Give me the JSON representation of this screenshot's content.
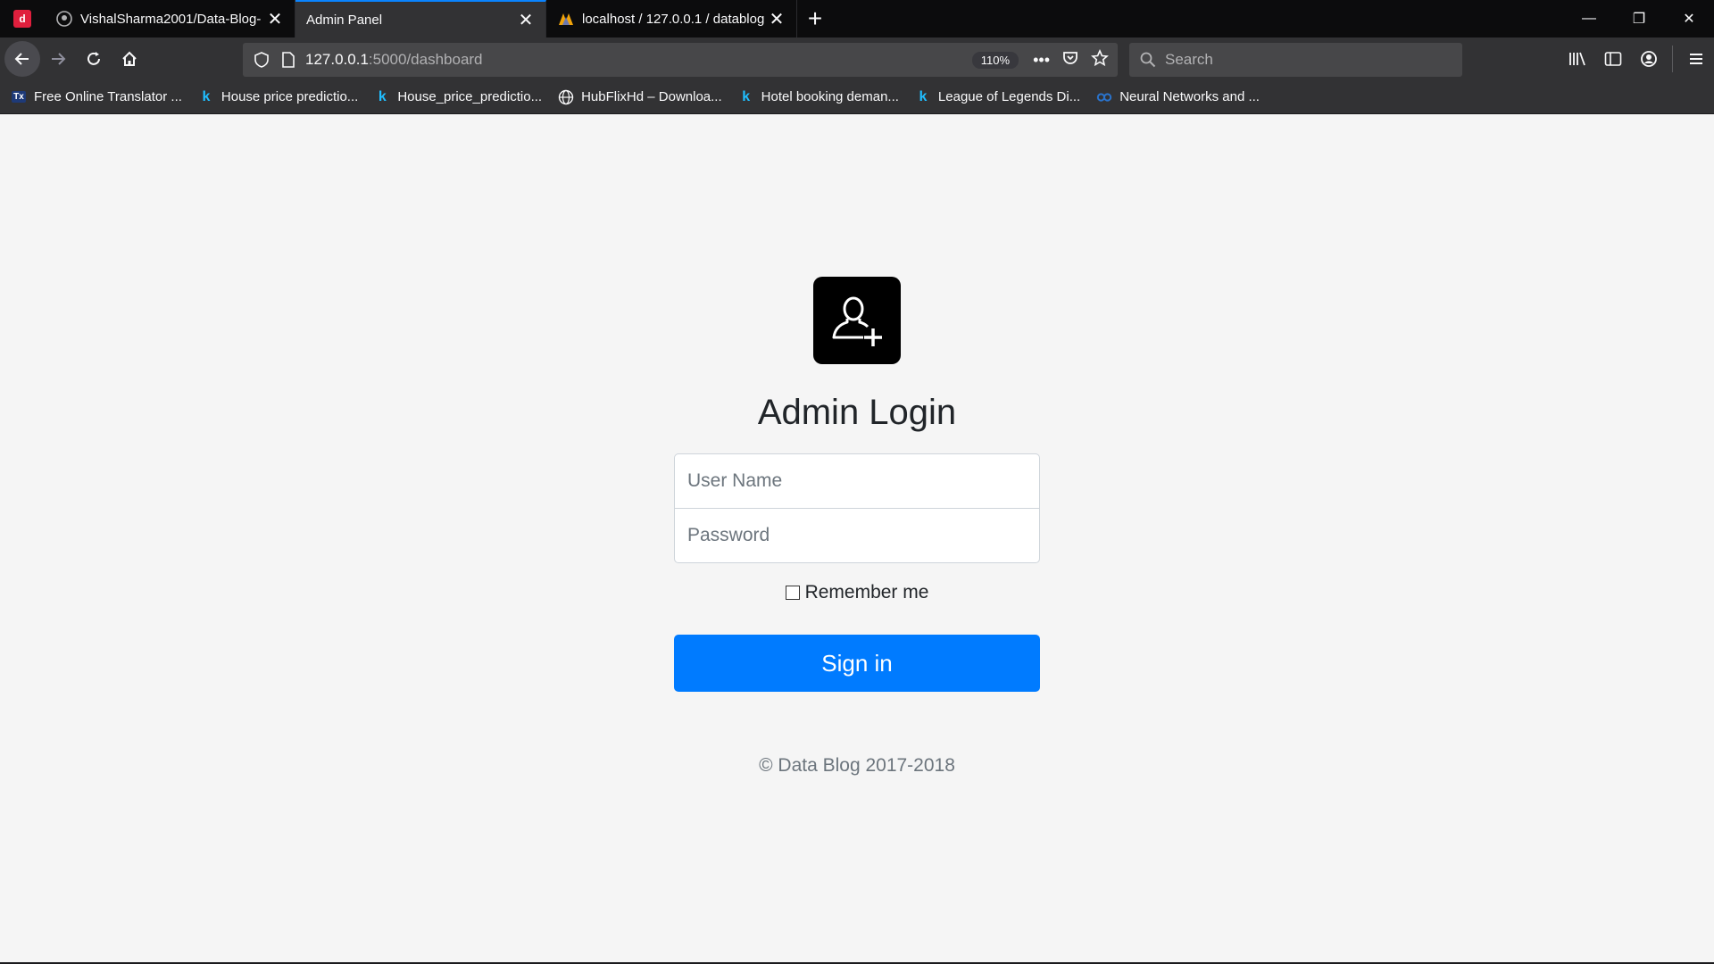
{
  "browser": {
    "tabs": [
      {
        "title": "VishalSharma2001/Data-Blog-",
        "icon": "github-icon",
        "active": false
      },
      {
        "title": "Admin Panel",
        "icon": "",
        "active": true
      },
      {
        "title": "localhost / 127.0.0.1 / datablog",
        "icon": "phpmyadmin-icon",
        "active": false
      }
    ],
    "url_host": "127.0.0.1",
    "url_path": ":5000/dashboard",
    "zoom": "110%",
    "search_placeholder": "Search",
    "bookmarks": [
      {
        "label": "Free Online Translator ...",
        "icon": "tx-icon"
      },
      {
        "label": "House price predictio...",
        "icon": "kaggle-icon"
      },
      {
        "label": "House_price_predictio...",
        "icon": "kaggle-icon"
      },
      {
        "label": "HubFlixHd – Downloa...",
        "icon": "globe-icon"
      },
      {
        "label": "Hotel booking deman...",
        "icon": "kaggle-icon"
      },
      {
        "label": "League of Legends Di...",
        "icon": "kaggle-icon"
      },
      {
        "label": "Neural Networks and ...",
        "icon": "coursera-icon"
      }
    ]
  },
  "login": {
    "title": "Admin Login",
    "username_placeholder": "User Name",
    "password_placeholder": "Password",
    "remember_label": "Remember me",
    "signin_label": "Sign in",
    "footer": "© Data Blog 2017-2018"
  },
  "colors": {
    "accent": "#007bff",
    "tab_active_indicator": "#0a84ff",
    "page_bg": "#f5f5f5"
  }
}
